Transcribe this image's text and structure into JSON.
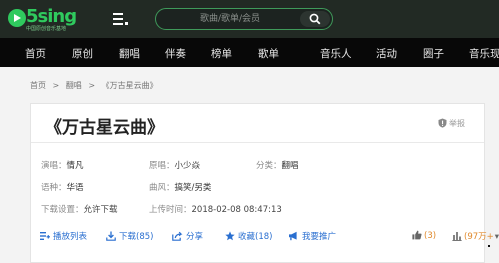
{
  "header": {
    "logo_text": "5sing",
    "logo_sub": "中国原创音乐基地",
    "search_placeholder": "歌曲/歌单/会员"
  },
  "nav": {
    "items": [
      "首页",
      "原创",
      "翻唱",
      "伴奏",
      "榜单",
      "歌单",
      "音乐人",
      "活动",
      "圈子",
      "音乐现"
    ]
  },
  "breadcrumb": {
    "items": [
      "首页",
      "翻唱",
      "《万古星云曲》"
    ],
    "separator": ">"
  },
  "song": {
    "title": "《万古星云曲》",
    "report_label": "举报",
    "singer_label": "演唱：",
    "singer": "情凡",
    "original_label": "原唱：",
    "original": "小少焱",
    "category_label": "分类：",
    "category": "翻唱",
    "language_label": "语种：",
    "language": "华语",
    "style_label": "曲风：",
    "style": "搞笑/另类",
    "download_label": "下载设置：",
    "download": "允许下载",
    "upload_label": "上传时间：",
    "upload_time": "2018-02-08 08:47:13"
  },
  "actions": {
    "playlist": "播放列表",
    "download": "下载(85)",
    "share": "分享",
    "collect": "收藏(18)",
    "promote": "我要推广",
    "likes": "(3)",
    "plays": "(97万+",
    "plays_arrow": "▾"
  },
  "colors": {
    "brand_green": "#2fca5e",
    "link_blue": "#2a6fd0",
    "count_orange": "#e0892b"
  }
}
